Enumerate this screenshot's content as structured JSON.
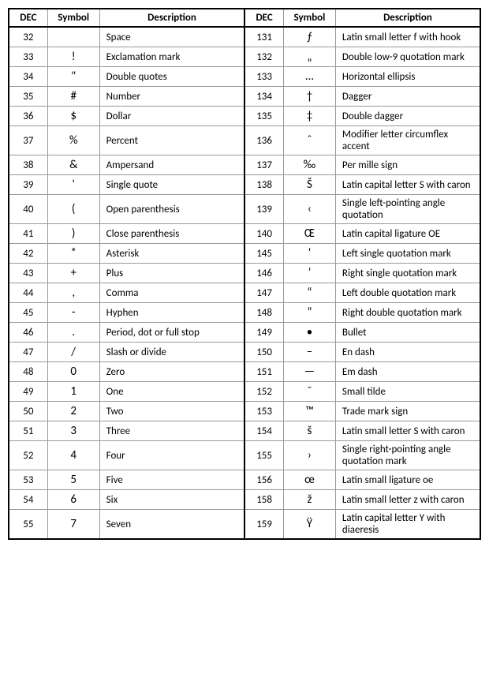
{
  "headers": {
    "dec": "DEC",
    "symbol": "Symbol",
    "description": "Description"
  },
  "chart_data": {
    "type": "table",
    "title": "",
    "columns": [
      "DEC",
      "Symbol",
      "Description",
      "DEC",
      "Symbol",
      "Description"
    ],
    "left": [
      {
        "dec": "32",
        "sym": "",
        "desc": "Space"
      },
      {
        "dec": "33",
        "sym": "!",
        "desc": "Exclamation mark"
      },
      {
        "dec": "34",
        "sym": "\"",
        "desc": "Double quotes"
      },
      {
        "dec": "35",
        "sym": "#",
        "desc": "Number"
      },
      {
        "dec": "36",
        "sym": "$",
        "desc": "Dollar"
      },
      {
        "dec": "37",
        "sym": "%",
        "desc": "Percent"
      },
      {
        "dec": "38",
        "sym": "&",
        "desc": "Ampersand"
      },
      {
        "dec": "39",
        "sym": "'",
        "desc": "Single quote"
      },
      {
        "dec": "40",
        "sym": "(",
        "desc": "Open parenthesis"
      },
      {
        "dec": "41",
        "sym": ")",
        "desc": "Close parenthesis"
      },
      {
        "dec": "42",
        "sym": "*",
        "desc": "Asterisk"
      },
      {
        "dec": "43",
        "sym": "+",
        "desc": "Plus"
      },
      {
        "dec": "44",
        "sym": ",",
        "desc": "Comma"
      },
      {
        "dec": "45",
        "sym": "-",
        "desc": "Hyphen"
      },
      {
        "dec": "46",
        "sym": ".",
        "desc": "Period, dot or full stop"
      },
      {
        "dec": "47",
        "sym": "/",
        "desc": "Slash or divide"
      },
      {
        "dec": "48",
        "sym": "0",
        "desc": "Zero"
      },
      {
        "dec": "49",
        "sym": "1",
        "desc": "One"
      },
      {
        "dec": "50",
        "sym": "2",
        "desc": "Two"
      },
      {
        "dec": "51",
        "sym": "3",
        "desc": "Three"
      },
      {
        "dec": "52",
        "sym": "4",
        "desc": "Four"
      },
      {
        "dec": "53",
        "sym": "5",
        "desc": "Five"
      },
      {
        "dec": "54",
        "sym": "6",
        "desc": "Six"
      },
      {
        "dec": "55",
        "sym": "7",
        "desc": "Seven"
      }
    ],
    "right": [
      {
        "dec": "131",
        "sym": "ƒ",
        "desc": "Latin small letter f with hook"
      },
      {
        "dec": "132",
        "sym": "„",
        "desc": "Double low-9 quotation mark"
      },
      {
        "dec": "133",
        "sym": "…",
        "desc": "Horizontal ellipsis"
      },
      {
        "dec": "134",
        "sym": "†",
        "desc": "Dagger"
      },
      {
        "dec": "135",
        "sym": "‡",
        "desc": "Double dagger"
      },
      {
        "dec": "136",
        "sym": "ˆ",
        "desc": "Modifier letter circumflex accent"
      },
      {
        "dec": "137",
        "sym": "‰",
        "desc": "Per mille sign"
      },
      {
        "dec": "138",
        "sym": "Š",
        "desc": "Latin capital letter S with caron"
      },
      {
        "dec": "139",
        "sym": "‹",
        "desc": "Single left-pointing angle quotation"
      },
      {
        "dec": "140",
        "sym": "Œ",
        "desc": "Latin capital ligature OE"
      },
      {
        "dec": "145",
        "sym": "‘",
        "desc": "Left single quotation mark"
      },
      {
        "dec": "146",
        "sym": "’",
        "desc": "Right single quotation mark"
      },
      {
        "dec": "147",
        "sym": "“",
        "desc": "Left double quotation mark"
      },
      {
        "dec": "148",
        "sym": "”",
        "desc": "Right double quotation mark"
      },
      {
        "dec": "149",
        "sym": "•",
        "desc": "Bullet"
      },
      {
        "dec": "150",
        "sym": "–",
        "desc": "En dash"
      },
      {
        "dec": "151",
        "sym": "—",
        "desc": "Em dash"
      },
      {
        "dec": "152",
        "sym": "˜",
        "desc": "Small tilde"
      },
      {
        "dec": "153",
        "sym": "™",
        "desc": "Trade mark sign"
      },
      {
        "dec": "154",
        "sym": "š",
        "desc": "Latin small letter S with caron"
      },
      {
        "dec": "155",
        "sym": "›",
        "desc": "Single right-pointing angle quotation mark"
      },
      {
        "dec": "156",
        "sym": "œ",
        "desc": "Latin small ligature oe"
      },
      {
        "dec": "158",
        "sym": "ž",
        "desc": "Latin small letter z with caron"
      },
      {
        "dec": "159",
        "sym": "Ÿ",
        "desc": "Latin capital letter Y with diaeresis"
      }
    ]
  }
}
